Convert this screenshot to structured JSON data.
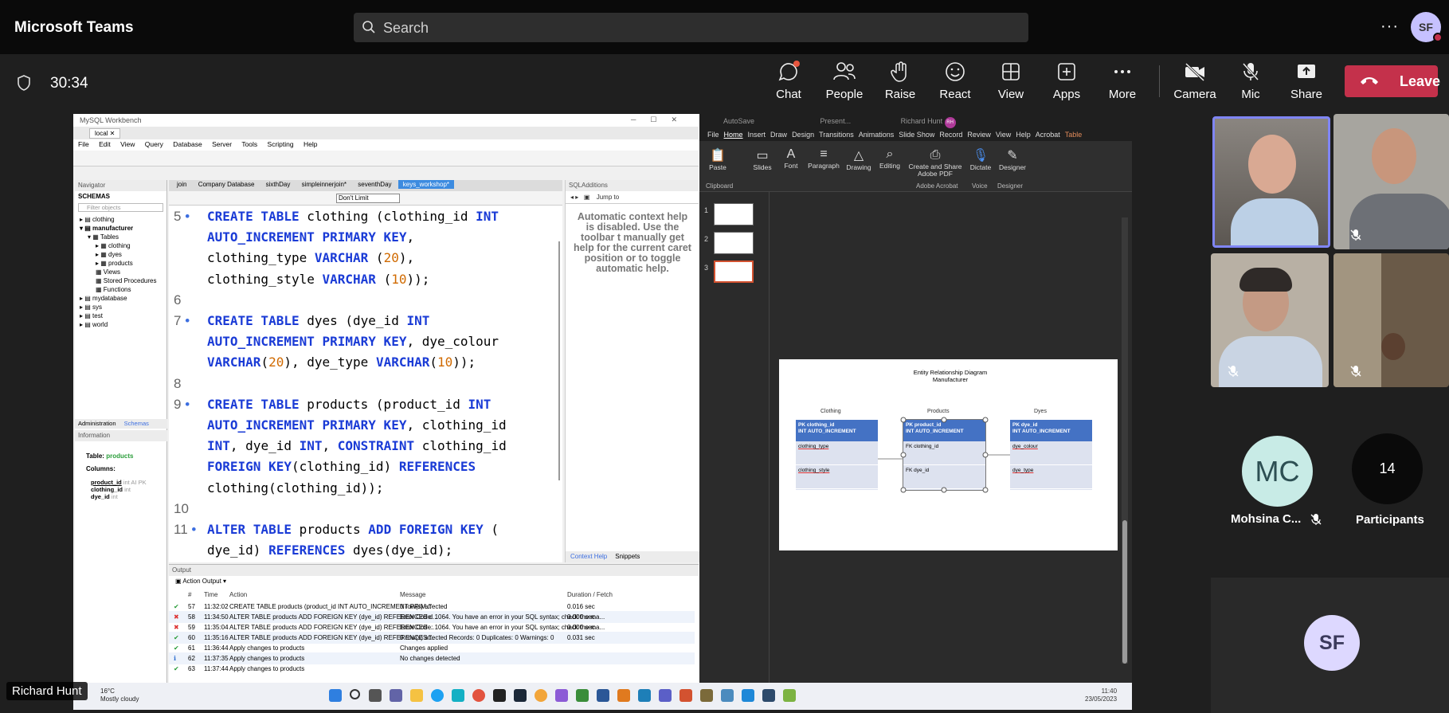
{
  "teams": {
    "app_name": "Microsoft Teams",
    "search_placeholder": "Search",
    "more_label": "···",
    "user_initials": "SF",
    "timer": "30:34",
    "controls": [
      "Chat",
      "People",
      "Raise",
      "React",
      "View",
      "Apps",
      "More",
      "Camera",
      "Mic",
      "Share"
    ],
    "leave_label": "Leave",
    "presenter_name": "Richard Hunt",
    "accent": "#c4314b"
  },
  "workbench": {
    "window_title": "MySQL Workbench",
    "connection_tab": "local",
    "menu": [
      "File",
      "Edit",
      "View",
      "Query",
      "Database",
      "Server",
      "Tools",
      "Scripting",
      "Help"
    ],
    "navigator_header": "Navigator",
    "schemas_header": "SCHEMAS",
    "filter_placeholder": "Filter objects",
    "tree": [
      "clothing",
      "manufacturer",
      "Tables",
      "clothing",
      "dyes",
      "products",
      "Views",
      "Stored Procedures",
      "Functions",
      "mydatabase",
      "sys",
      "test",
      "world"
    ],
    "bottom_tabs": [
      "Administration",
      "Schemas"
    ],
    "info_header": "Information",
    "info_table_label": "Table:",
    "info_table_name": "products",
    "info_columns_label": "Columns:",
    "info_columns": [
      {
        "name": "product_id",
        "type": "int AI PK"
      },
      {
        "name": "clothing_id",
        "type": "int"
      },
      {
        "name": "dye_id",
        "type": "int"
      }
    ],
    "editor_tabs": [
      "join",
      "Company Database",
      "sixthDay",
      "simpleinnerjoin*",
      "seventhDay",
      "keys_workshop*"
    ],
    "limit_select": "Don't Limit",
    "code_lines": [
      {
        "n": "5",
        "dot": "•",
        "t": "<k>CREATE TABLE</k> clothing (clothing_id <k>INT</k>"
      },
      {
        "n": "",
        "dot": "",
        "t": "<k>AUTO_INCREMENT PRIMARY KEY</k>,"
      },
      {
        "n": "",
        "dot": "",
        "t": "clothing_type <k>VARCHAR</k> (<m>20</m>),"
      },
      {
        "n": "",
        "dot": "",
        "t": "clothing_style <k>VARCHAR</k> (<m>10</m>));"
      },
      {
        "n": "6",
        "dot": "",
        "t": ""
      },
      {
        "n": "7",
        "dot": "•",
        "t": "<k>CREATE TABLE</k> dyes (dye_id <k>INT</k>"
      },
      {
        "n": "",
        "dot": "",
        "t": "<k>AUTO_INCREMENT PRIMARY KEY</k>, dye_colour"
      },
      {
        "n": "",
        "dot": "",
        "t": "<k>VARCHAR</k>(<m>20</m>), dye_type <k>VARCHAR</k>(<m>10</m>));"
      },
      {
        "n": "8",
        "dot": "",
        "t": ""
      },
      {
        "n": "9",
        "dot": "•",
        "t": "<k>CREATE TABLE</k> products (product_id <k>INT</k>"
      },
      {
        "n": "",
        "dot": "",
        "t": "<k>AUTO_INCREMENT PRIMARY KEY</k>, clothing_id"
      },
      {
        "n": "",
        "dot": "",
        "t": "<k>INT</k>, dye_id <k>INT</k>, <k>CONSTRAINT</k> clothing_id"
      },
      {
        "n": "",
        "dot": "",
        "t": "<k>FOREIGN KEY</k>(clothing_id) <k>REFERENCES</k>"
      },
      {
        "n": "",
        "dot": "",
        "t": "clothing(clothing_id));"
      },
      {
        "n": "10",
        "dot": "",
        "t": ""
      },
      {
        "n": "11",
        "dot": "•",
        "t": "<k>ALTER TABLE</k> products <k>ADD FOREIGN KEY</k> ("
      },
      {
        "n": "",
        "dot": "",
        "t": "dye_id) <k>REFERENCES</k> dyes(dye_id);"
      }
    ],
    "sql_additions_header": "SQLAdditions",
    "jump_to": "Jump to",
    "context_help_msg": "Automatic context help is disabled. Use the toolbar t manually get help for the current caret position or to toggle automatic help.",
    "context_tabs": [
      "Context Help",
      "Snippets"
    ],
    "output_header": "Output",
    "output_select": "Action Output",
    "output_columns": [
      "#",
      "Time",
      "Action",
      "Message",
      "Duration / Fetch"
    ],
    "output_rows": [
      {
        "status": "ok",
        "n": "57",
        "time": "11:32:02",
        "action": "CREATE TABLE products (product_id INT AUTO_INCREMENT PRIM...",
        "msg": "0 row(s) affected",
        "dur": "0.016 sec"
      },
      {
        "status": "err",
        "n": "58",
        "time": "11:34:50",
        "action": "ALTER TABLE products ADD FOREIGN KEY (dye_id) REFERENCES d...",
        "msg": "Error Code: 1064. You have an error in your SQL syntax; check the ma...",
        "dur": "0.000 sec"
      },
      {
        "status": "err",
        "n": "59",
        "time": "11:35:04",
        "action": "ALTER TABLE products ADD FOREIGN KEY (dye_id) REFERENCES ...",
        "msg": "Error Code: 1064. You have an error in your SQL syntax; check the ma...",
        "dur": "0.000 sec"
      },
      {
        "status": "ok",
        "n": "60",
        "time": "11:35:16",
        "action": "ALTER TABLE products ADD FOREIGN KEY (dye_id) REFERENCES ...",
        "msg": "0 row(s) affected Records: 0  Duplicates: 0  Warnings: 0",
        "dur": "0.031 sec"
      },
      {
        "status": "ok",
        "n": "61",
        "time": "11:36:44",
        "action": "Apply changes to products",
        "msg": "Changes applied",
        "dur": ""
      },
      {
        "status": "inf",
        "n": "62",
        "time": "11:37:35",
        "action": "Apply changes to products",
        "msg": "No changes detected",
        "dur": ""
      },
      {
        "status": "ok",
        "n": "63",
        "time": "11:37:44",
        "action": "Apply changes to products",
        "msg": "",
        "dur": ""
      }
    ]
  },
  "powerpoint": {
    "autosave": "AutoSave",
    "doc_name": "Present...",
    "user": "Richard Hunt",
    "user_initials": "RH",
    "menu": [
      "File",
      "Home",
      "Insert",
      "Draw",
      "Design",
      "Transitions",
      "Animations",
      "Slide Show",
      "Record",
      "Review",
      "View",
      "Help",
      "Acrobat",
      "Table"
    ],
    "ribbon": [
      "Paste",
      "Slides",
      "Font",
      "Paragraph",
      "Drawing",
      "Editing",
      "Create and Share Adobe PDF",
      "Dictate",
      "Designer"
    ],
    "ribbon_groups": [
      "Clipboard",
      "Adobe Acrobat",
      "Voice",
      "Designer"
    ],
    "thumb_numbers": [
      "1",
      "2",
      "3"
    ],
    "slide": {
      "title_line1": "Entity Relationship Diagram",
      "title_line2": "Manufacturer",
      "entities": [
        {
          "label": "Clothing",
          "pk1": "PK clothing_id",
          "pk2": "INT AUTO_INCREMENT",
          "f1": "clothing_type",
          "f2": "clothing_style"
        },
        {
          "label": "Products",
          "pk1": "PK product_id",
          "pk2": "INT AUTO_INCREMENT",
          "f1": "FK clothing_id",
          "f2": "FK dye_id"
        },
        {
          "label": "Dyes",
          "pk1": "PK dye_id",
          "pk2": "INT AUTO_INCREMENT",
          "f1": "dye_colour",
          "f2": "dye_type"
        }
      ]
    }
  },
  "taskbar": {
    "temp": "16°C",
    "weather": "Mostly cloudy",
    "time": "11:40",
    "date": "23/05/2023"
  },
  "participants": {
    "mc_initials": "MC",
    "mc_name": "Mohsina C...",
    "count": "14",
    "count_label": "Participants",
    "sf_initials": "SF"
  }
}
